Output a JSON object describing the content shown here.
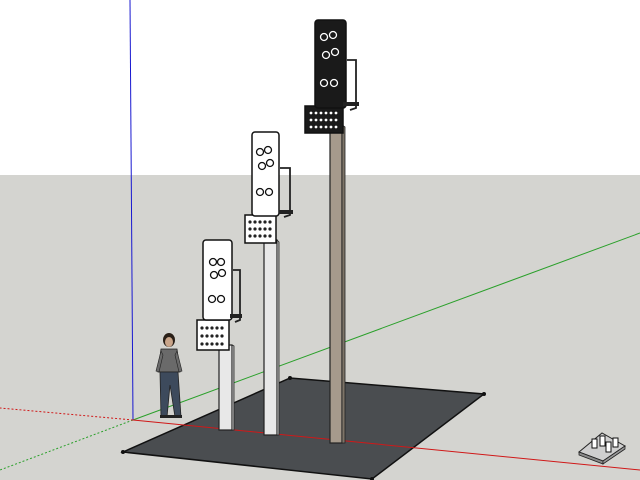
{
  "viewport": {
    "sky_color": "#ffffff",
    "ground_color": "#d4d4d0",
    "base_slab_color": "#4a4d50",
    "axis_colors": {
      "red": "#d01818",
      "green": "#2aa02a",
      "blue": "#1818d0"
    }
  },
  "model": {
    "signals": [
      {
        "name": "short-white-signal",
        "head_color": "#ffffff",
        "pole_color": "#e8e8e8"
      },
      {
        "name": "medium-white-signal",
        "head_color": "#ffffff",
        "pole_color": "#e8e8e8"
      },
      {
        "name": "tall-black-signal",
        "head_color": "#1a1a1a",
        "pole_color": "#a69a8c"
      }
    ],
    "scale_figure": {
      "shirt_color": "#6a6a6a",
      "pants_color": "#3d4a5c",
      "hair_color": "#2a2018"
    }
  },
  "navigation": {
    "icon": "view-navigator-icon"
  }
}
